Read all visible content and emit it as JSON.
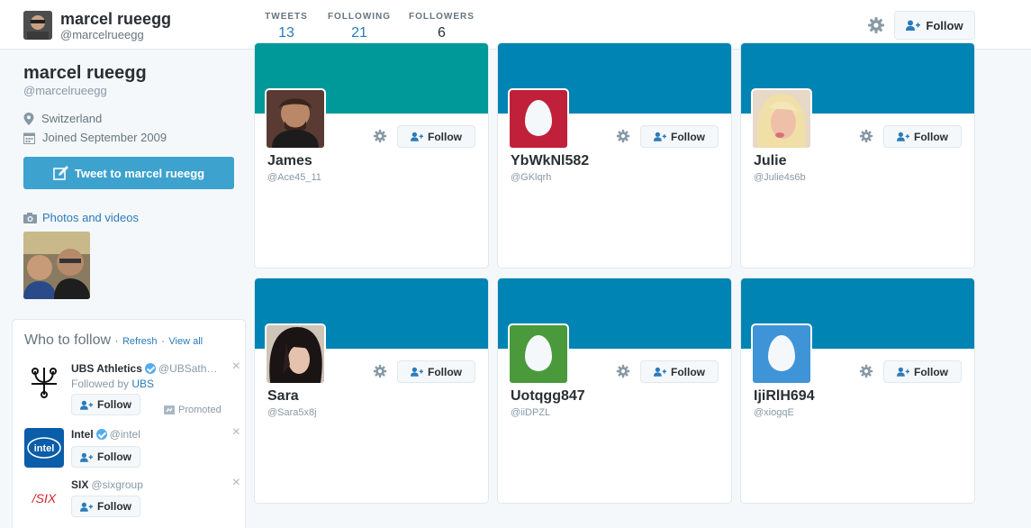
{
  "header": {
    "name": "marcel rueegg",
    "handle": "@marcelrueegg",
    "stats": [
      {
        "label": "TWEETS",
        "value": "13"
      },
      {
        "label": "FOLLOWING",
        "value": "21"
      },
      {
        "label": "FOLLOWERS",
        "value": "6"
      }
    ],
    "follow_label": "Follow"
  },
  "sidebar": {
    "name": "marcel rueegg",
    "handle": "@marcelrueegg",
    "location": "Switzerland",
    "joined": "Joined September 2009",
    "tweet_to_label": "Tweet to marcel rueegg",
    "photos_videos_label": "Photos and videos"
  },
  "who_to_follow": {
    "title": "Who to follow",
    "refresh_label": "Refresh",
    "view_all_label": "View all",
    "separator": "·",
    "suggestions": [
      {
        "name": "UBS Athletics",
        "handle": "@UBSath…",
        "verified": true,
        "followed_by_prefix": "Followed by",
        "followed_by": "UBS",
        "follow_label": "Follow",
        "promoted_label": "Promoted"
      },
      {
        "name": "Intel",
        "handle": "@intel",
        "verified": true,
        "follow_label": "Follow"
      },
      {
        "name": "SIX",
        "handle": "@sixgroup",
        "verified": false,
        "follow_label": "Follow"
      }
    ]
  },
  "followers": [
    {
      "name": "James",
      "handle": "@Ace45_11",
      "banner_color": "#009999",
      "avatar": "photo",
      "follow_label": "Follow"
    },
    {
      "name": "YbWkNl582",
      "handle": "@GKlqrh",
      "banner_color": "#0084b4",
      "avatar": "egg",
      "avatar_color": "#c0203a",
      "follow_label": "Follow"
    },
    {
      "name": "Julie",
      "handle": "@Julie4s6b",
      "banner_color": "#0084b4",
      "avatar": "photo",
      "follow_label": "Follow"
    },
    {
      "name": "Sara",
      "handle": "@Sara5x8j",
      "banner_color": "#0084b4",
      "avatar": "photo",
      "follow_label": "Follow"
    },
    {
      "name": "Uotqgg847",
      "handle": "@iiDPZL",
      "banner_color": "#0084b4",
      "avatar": "egg",
      "avatar_color": "#4a9a3c",
      "follow_label": "Follow"
    },
    {
      "name": "IjiRlH694",
      "handle": "@xiogqE",
      "banner_color": "#0084b4",
      "avatar": "egg",
      "avatar_color": "#3f94d8",
      "follow_label": "Follow"
    }
  ],
  "colors": {
    "link": "#2b7bb9",
    "tweet_button": "#3ea2ce"
  },
  "icons": [
    "gear-icon",
    "add-user-icon",
    "location-pin-icon",
    "calendar-icon",
    "camera-icon",
    "compose-icon",
    "verified-icon",
    "close-icon",
    "promoted-icon"
  ]
}
